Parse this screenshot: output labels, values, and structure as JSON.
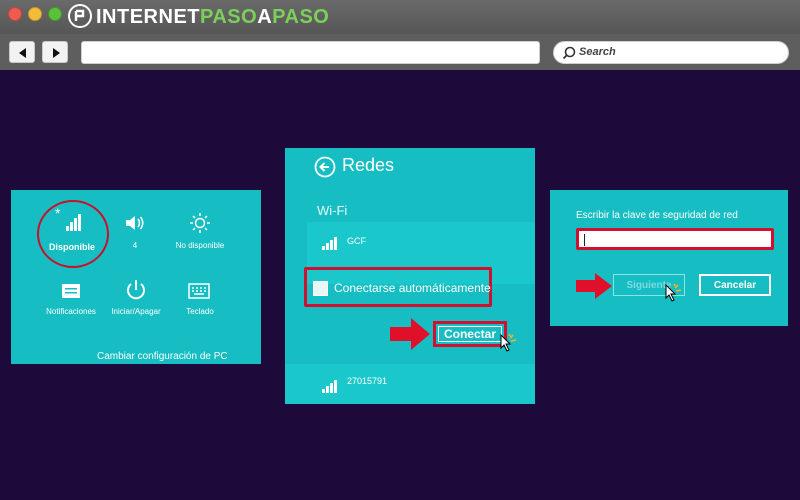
{
  "browser": {
    "logo_part1": "INTERNET",
    "logo_part2": "PASO",
    "logo_part3": "A",
    "logo_part4": "PASO",
    "url": "",
    "search_placeholder": "Search"
  },
  "quick_settings": {
    "items": [
      {
        "label": "Disponible",
        "icon": "wifi-signal-icon"
      },
      {
        "label": "4",
        "icon": "volume-icon"
      },
      {
        "label": "No disponible",
        "icon": "brightness-icon"
      },
      {
        "label": "Notificaciones",
        "icon": "notifications-icon"
      },
      {
        "label": "Iniciar/Apagar",
        "icon": "power-icon"
      },
      {
        "label": "Teclado",
        "icon": "keyboard-icon"
      }
    ],
    "footer": "Cambiar configuración de PC"
  },
  "networks_panel": {
    "title": "Redes",
    "section": "Wi-Fi",
    "networks": [
      {
        "ssid": "GCF"
      },
      {
        "ssid": "27015791"
      }
    ],
    "auto_connect_label": "Conectarse automáticamente",
    "connect_label": "Conectar"
  },
  "key_panel": {
    "label": "Escribir la clave de seguridad de red",
    "input_value": "",
    "next_label": "Siguiente",
    "cancel_label": "Cancelar"
  },
  "colors": {
    "panel": "#16bec3",
    "background": "#1d0a3a",
    "highlight": "#d0102e",
    "logo_accent": "#7cd05a"
  }
}
